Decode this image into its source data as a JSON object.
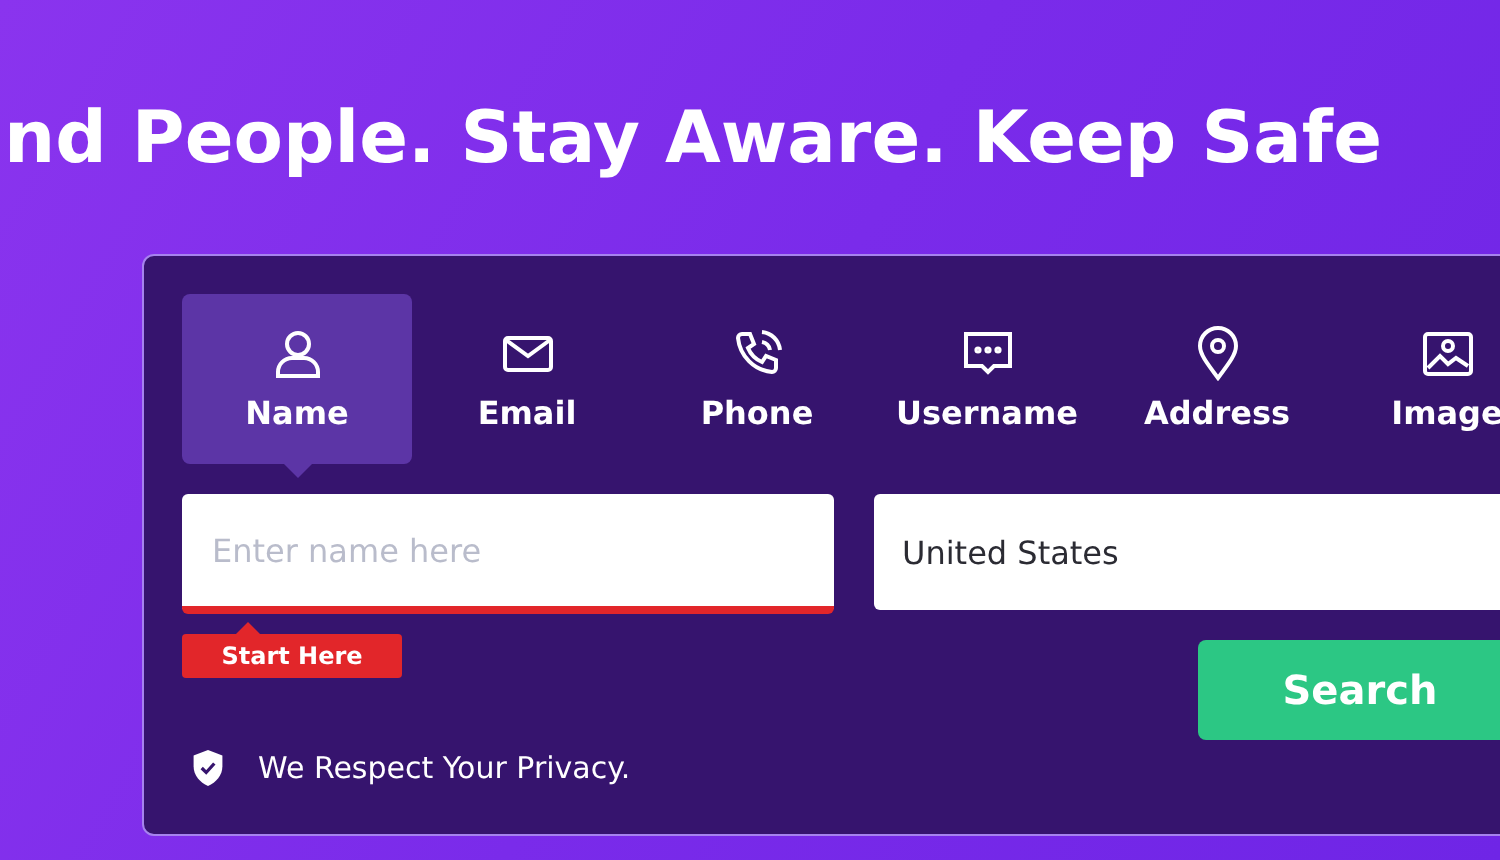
{
  "headline": "nd People. Stay Aware. Keep Safe",
  "tabs": [
    {
      "kind": "person",
      "label": "Name",
      "selected": true
    },
    {
      "kind": "mail",
      "label": "Email",
      "selected": false
    },
    {
      "kind": "phone",
      "label": "Phone",
      "selected": false
    },
    {
      "kind": "chat",
      "label": "Username",
      "selected": false
    },
    {
      "kind": "pin",
      "label": "Address",
      "selected": false
    },
    {
      "kind": "image",
      "label": "Image",
      "selected": false
    }
  ],
  "name_field": {
    "placeholder": "Enter name here"
  },
  "start_hint": "Start Here",
  "country_field": {
    "value": "United States"
  },
  "search_button": "Search",
  "privacy_note": "We Respect Your Privacy."
}
